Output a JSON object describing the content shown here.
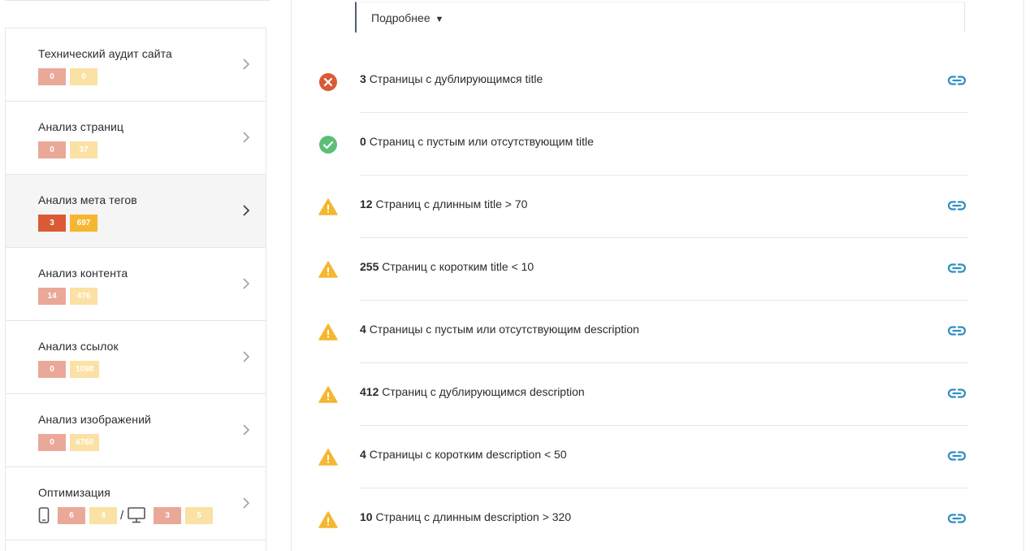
{
  "colors": {
    "error": "#d95a35",
    "error_light": "#eaa898",
    "warning": "#f5b730",
    "warning_light": "#fbe1a3",
    "success": "#5cbf77",
    "link": "#2f8fc0"
  },
  "sidebar": {
    "items": [
      {
        "label": "Технический аудит сайта",
        "errors": "0",
        "warnings": "0"
      },
      {
        "label": "Анализ страниц",
        "errors": "0",
        "warnings": "37"
      },
      {
        "label": "Анализ мета тегов",
        "errors": "3",
        "warnings": "697",
        "active": true
      },
      {
        "label": "Анализ контента",
        "errors": "14",
        "warnings": "476"
      },
      {
        "label": "Анализ ссылок",
        "errors": "0",
        "warnings": "1098"
      },
      {
        "label": "Анализ изображений",
        "errors": "0",
        "warnings": "4760"
      },
      {
        "label": "Оптимизация",
        "mobile_errors": "6",
        "mobile_warnings": "4",
        "separator": "/",
        "desktop_errors": "3",
        "desktop_warnings": "5",
        "icons": [
          "mobile-phone-icon",
          "desktop-monitor-icon"
        ]
      }
    ],
    "chevron_icon": "chevron-right-icon"
  },
  "main": {
    "details_label": "Подробнее",
    "details_arrow": "▼",
    "checks": [
      {
        "status": "error",
        "icon": "error-circle-icon",
        "count": "3",
        "text": "Страницы с дублирующимся title",
        "has_link": true
      },
      {
        "status": "ok",
        "icon": "check-circle-icon",
        "count": "0",
        "text": "Страниц с пустым или отсутствующим title",
        "has_link": false
      },
      {
        "status": "warning",
        "icon": "warning-triangle-icon",
        "count": "12",
        "text": "Страниц с длинным title > 70",
        "has_link": true
      },
      {
        "status": "warning",
        "icon": "warning-triangle-icon",
        "count": "255",
        "text": "Страниц с коротким title < 10",
        "has_link": true
      },
      {
        "status": "warning",
        "icon": "warning-triangle-icon",
        "count": "4",
        "text": "Страницы с пустым или отсутствующим description",
        "has_link": true
      },
      {
        "status": "warning",
        "icon": "warning-triangle-icon",
        "count": "412",
        "text": "Страниц с дублирующимся description",
        "has_link": true
      },
      {
        "status": "warning",
        "icon": "warning-triangle-icon",
        "count": "4",
        "text": "Страницы с коротким description < 50",
        "has_link": true
      },
      {
        "status": "warning",
        "icon": "warning-triangle-icon",
        "count": "10",
        "text": "Страниц с длинным description > 320",
        "has_link": true
      }
    ],
    "link_icon": "link-icon"
  }
}
